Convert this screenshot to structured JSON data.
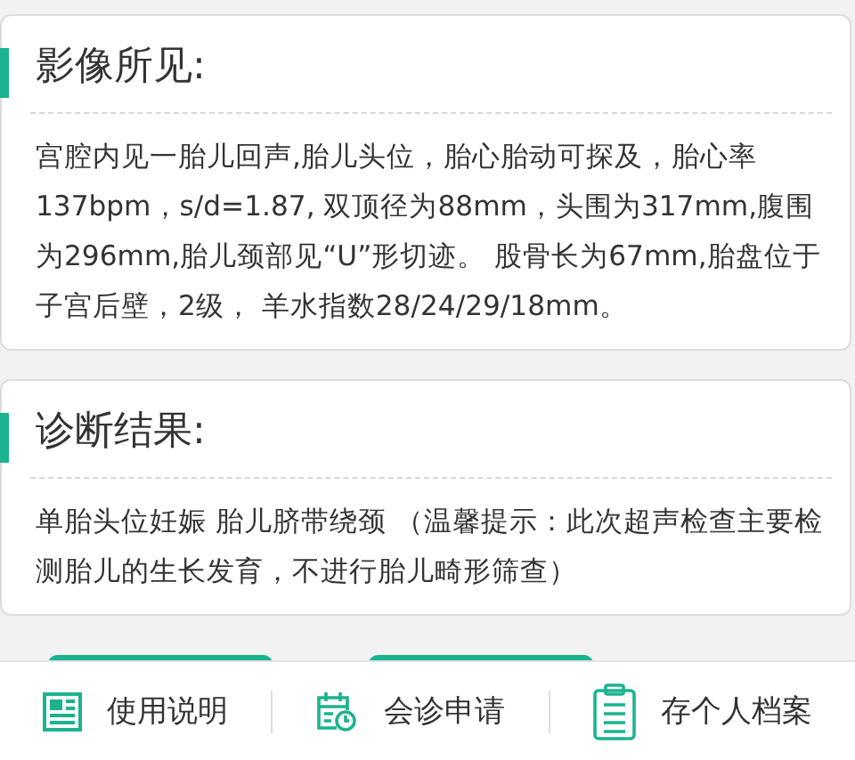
{
  "sections": [
    {
      "title": "影像所见:",
      "body": "宫腔内见一胎儿回声,胎儿头位，胎心胎动可探及，胎心率137bpm，s/d=1.87, 双顶径为88mm，头围为317mm,腹围为296mm,胎儿颈部见“U”形切迹。 股骨长为67mm,胎盘位于子宫后壁，2级， 羊水指数28/24/29/18mm。"
    },
    {
      "title": "诊断结果:",
      "body": "单胎头位妊娠 胎儿脐带绕颈 （温馨提示：此次超声检查主要检测胎儿的生长发育，不进行胎儿畸形筛查）"
    }
  ],
  "bottom_bar": [
    {
      "kind": "guide",
      "label": "使用说明"
    },
    {
      "kind": "calendar",
      "label": "会诊申请"
    },
    {
      "kind": "clipboard",
      "label": "存个人档案"
    }
  ]
}
